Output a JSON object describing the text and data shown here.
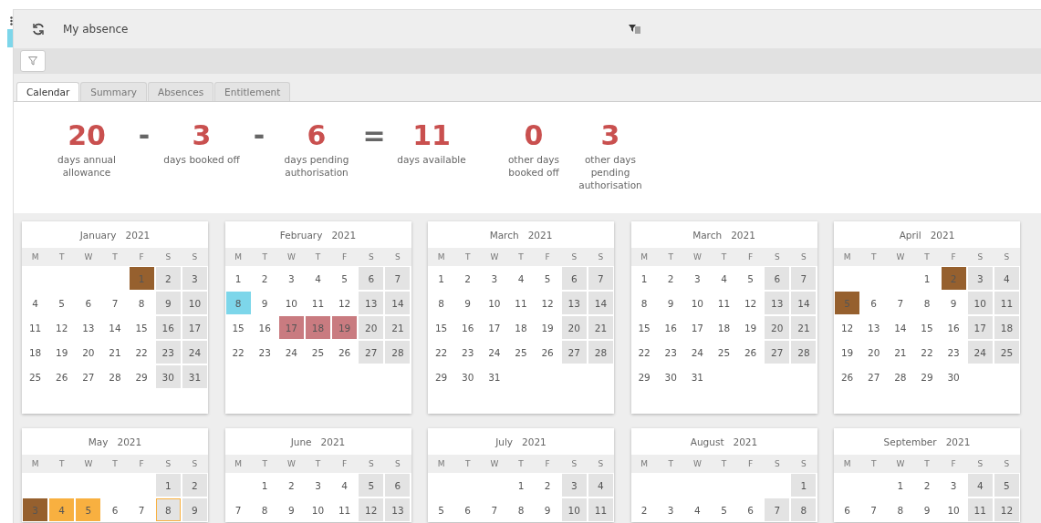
{
  "header": {
    "title": "My absence"
  },
  "tabs": [
    {
      "label": "Calendar",
      "selected": true
    },
    {
      "label": "Summary",
      "selected": false
    },
    {
      "label": "Absences",
      "selected": false
    },
    {
      "label": "Entitlement",
      "selected": false
    }
  ],
  "summary": [
    {
      "kind": "figure",
      "value": "20",
      "label": "days annual allowance"
    },
    {
      "kind": "operator",
      "value": "-"
    },
    {
      "kind": "figure",
      "value": "3",
      "label": "days booked off"
    },
    {
      "kind": "operator",
      "value": "-"
    },
    {
      "kind": "figure",
      "value": "6",
      "label": "days pending authorisation"
    },
    {
      "kind": "operator",
      "value": "="
    },
    {
      "kind": "figure",
      "value": "11",
      "label": "days available"
    },
    {
      "kind": "gap"
    },
    {
      "kind": "figure",
      "value": "0",
      "label": "other days booked off"
    },
    {
      "kind": "figure",
      "value": "3",
      "label": "other days pending authorisation"
    }
  ],
  "months": [
    {
      "name": "January",
      "year": "2021",
      "weekdays": [
        "M",
        "T",
        "W",
        "T",
        "F",
        "S",
        "S"
      ],
      "weeks": [
        [
          {
            "kind": "blank"
          },
          {
            "kind": "blank"
          },
          {
            "kind": "blank"
          },
          {
            "kind": "blank"
          },
          {
            "kind": "day",
            "day": "1",
            "color": "#96602e"
          },
          "2",
          "3"
        ],
        [
          "4",
          "5",
          "6",
          "7",
          "8",
          "9",
          "10"
        ],
        [
          "11",
          "12",
          "13",
          "14",
          "15",
          "16",
          "17"
        ],
        [
          "18",
          "19",
          "20",
          "21",
          "22",
          "23",
          "24"
        ],
        [
          "25",
          "26",
          "27",
          "28",
          "29",
          "30",
          "31"
        ],
        [
          {
            "kind": "blank"
          },
          {
            "kind": "blank"
          },
          {
            "kind": "blank"
          },
          {
            "kind": "blank"
          },
          {
            "kind": "blank"
          },
          {
            "kind": "blank"
          },
          {
            "kind": "blank"
          }
        ]
      ]
    },
    {
      "name": "February",
      "year": "2021",
      "weekdays": [
        "M",
        "T",
        "W",
        "T",
        "F",
        "S",
        "S"
      ],
      "weeks": [
        [
          "1",
          "2",
          "3",
          "4",
          "5",
          "6",
          "7"
        ],
        [
          {
            "kind": "day",
            "day": "8",
            "color": "#7dd6ea"
          },
          "9",
          "10",
          "11",
          "12",
          "13",
          "14"
        ],
        [
          "15",
          "16",
          {
            "kind": "day",
            "day": "17",
            "color": "#c97b80"
          },
          {
            "kind": "day",
            "day": "18",
            "color": "#c97b80"
          },
          {
            "kind": "day",
            "day": "19",
            "color": "#c97b80"
          },
          "20",
          "21"
        ],
        [
          "22",
          "23",
          "24",
          "25",
          "26",
          "27",
          "28"
        ],
        [
          {
            "kind": "blank"
          },
          {
            "kind": "blank"
          },
          {
            "kind": "blank"
          },
          {
            "kind": "blank"
          },
          {
            "kind": "blank"
          },
          {
            "kind": "blank"
          },
          {
            "kind": "blank"
          }
        ],
        [
          {
            "kind": "blank"
          },
          {
            "kind": "blank"
          },
          {
            "kind": "blank"
          },
          {
            "kind": "blank"
          },
          {
            "kind": "blank"
          },
          {
            "kind": "blank"
          },
          {
            "kind": "blank"
          }
        ]
      ]
    },
    {
      "name": "March",
      "year": "2021",
      "weekdays": [
        "M",
        "T",
        "W",
        "T",
        "F",
        "S",
        "S"
      ],
      "weeks": [
        [
          "1",
          "2",
          "3",
          "4",
          "5",
          "6",
          "7"
        ],
        [
          "8",
          "9",
          "10",
          "11",
          "12",
          "13",
          "14"
        ],
        [
          "15",
          "16",
          "17",
          "18",
          "19",
          "20",
          "21"
        ],
        [
          "22",
          "23",
          "24",
          "25",
          "26",
          "27",
          "28"
        ],
        [
          "29",
          "30",
          "31",
          {
            "kind": "blank"
          },
          {
            "kind": "blank"
          },
          {
            "kind": "blank"
          },
          {
            "kind": "blank"
          }
        ],
        [
          {
            "kind": "blank"
          },
          {
            "kind": "blank"
          },
          {
            "kind": "blank"
          },
          {
            "kind": "blank"
          },
          {
            "kind": "blank"
          },
          {
            "kind": "blank"
          },
          {
            "kind": "blank"
          }
        ]
      ]
    },
    {
      "name": "March",
      "year": "2021",
      "weekdays": [
        "M",
        "T",
        "W",
        "T",
        "F",
        "S",
        "S"
      ],
      "weeks": [
        [
          "1",
          "2",
          "3",
          "4",
          "5",
          "6",
          "7"
        ],
        [
          "8",
          "9",
          "10",
          "11",
          "12",
          "13",
          "14"
        ],
        [
          "15",
          "16",
          "17",
          "18",
          "19",
          "20",
          "21"
        ],
        [
          "22",
          "23",
          "24",
          "25",
          "26",
          "27",
          "28"
        ],
        [
          "29",
          "30",
          "31",
          {
            "kind": "blank"
          },
          {
            "kind": "blank"
          },
          {
            "kind": "blank"
          },
          {
            "kind": "blank"
          }
        ],
        [
          {
            "kind": "blank"
          },
          {
            "kind": "blank"
          },
          {
            "kind": "blank"
          },
          {
            "kind": "blank"
          },
          {
            "kind": "blank"
          },
          {
            "kind": "blank"
          },
          {
            "kind": "blank"
          }
        ]
      ]
    },
    {
      "name": "April",
      "year": "2021",
      "weekdays": [
        "M",
        "T",
        "W",
        "T",
        "F",
        "S",
        "S"
      ],
      "weeks": [
        [
          {
            "kind": "blank"
          },
          {
            "kind": "blank"
          },
          {
            "kind": "blank"
          },
          "1",
          {
            "kind": "day",
            "day": "2",
            "color": "#96602e"
          },
          "3",
          "4"
        ],
        [
          {
            "kind": "day",
            "day": "5",
            "color": "#96602e"
          },
          "6",
          "7",
          "8",
          "9",
          "10",
          "11"
        ],
        [
          "12",
          "13",
          "14",
          "15",
          "16",
          "17",
          "18"
        ],
        [
          "19",
          "20",
          "21",
          "22",
          "23",
          "24",
          "25"
        ],
        [
          "26",
          "27",
          "28",
          "29",
          "30",
          {
            "kind": "blank"
          },
          {
            "kind": "blank"
          }
        ],
        [
          {
            "kind": "blank"
          },
          {
            "kind": "blank"
          },
          {
            "kind": "blank"
          },
          {
            "kind": "blank"
          },
          {
            "kind": "blank"
          },
          {
            "kind": "blank"
          },
          {
            "kind": "blank"
          }
        ]
      ]
    },
    {
      "name": "May",
      "year": "2021",
      "weekdays": [
        "M",
        "T",
        "W",
        "T",
        "F",
        "S",
        "S"
      ],
      "weeks": [
        [
          {
            "kind": "blank"
          },
          {
            "kind": "blank"
          },
          {
            "kind": "blank"
          },
          {
            "kind": "blank"
          },
          {
            "kind": "blank"
          },
          "1",
          "2"
        ],
        [
          {
            "kind": "day",
            "day": "3",
            "color": "#96602e"
          },
          {
            "kind": "day",
            "day": "4",
            "color": "#f8b040"
          },
          {
            "kind": "day",
            "day": "5",
            "color": "#f8b040"
          },
          "6",
          "7",
          {
            "kind": "day",
            "day": "8",
            "today": true
          },
          "9"
        ]
      ]
    },
    {
      "name": "June",
      "year": "2021",
      "weekdays": [
        "M",
        "T",
        "W",
        "T",
        "F",
        "S",
        "S"
      ],
      "weeks": [
        [
          {
            "kind": "blank"
          },
          "1",
          "2",
          "3",
          "4",
          "5",
          "6"
        ],
        [
          "7",
          "8",
          "9",
          "10",
          "11",
          "12",
          "13"
        ]
      ]
    },
    {
      "name": "July",
      "year": "2021",
      "weekdays": [
        "M",
        "T",
        "W",
        "T",
        "F",
        "S",
        "S"
      ],
      "weeks": [
        [
          {
            "kind": "blank"
          },
          {
            "kind": "blank"
          },
          {
            "kind": "blank"
          },
          "1",
          "2",
          "3",
          "4"
        ],
        [
          "5",
          "6",
          "7",
          "8",
          "9",
          "10",
          "11"
        ]
      ]
    },
    {
      "name": "August",
      "year": "2021",
      "weekdays": [
        "M",
        "T",
        "W",
        "T",
        "F",
        "S",
        "S"
      ],
      "weeks": [
        [
          {
            "kind": "blank"
          },
          {
            "kind": "blank"
          },
          {
            "kind": "blank"
          },
          {
            "kind": "blank"
          },
          {
            "kind": "blank"
          },
          {
            "kind": "blank"
          },
          "1"
        ],
        [
          "2",
          "3",
          "4",
          "5",
          "6",
          "7",
          "8"
        ]
      ]
    },
    {
      "name": "September",
      "year": "2021",
      "weekdays": [
        "M",
        "T",
        "W",
        "T",
        "F",
        "S",
        "S"
      ],
      "weeks": [
        [
          {
            "kind": "blank"
          },
          {
            "kind": "blank"
          },
          "1",
          "2",
          "3",
          "4",
          "5"
        ],
        [
          "6",
          "7",
          "8",
          "9",
          "10",
          "11",
          "12"
        ]
      ]
    }
  ]
}
